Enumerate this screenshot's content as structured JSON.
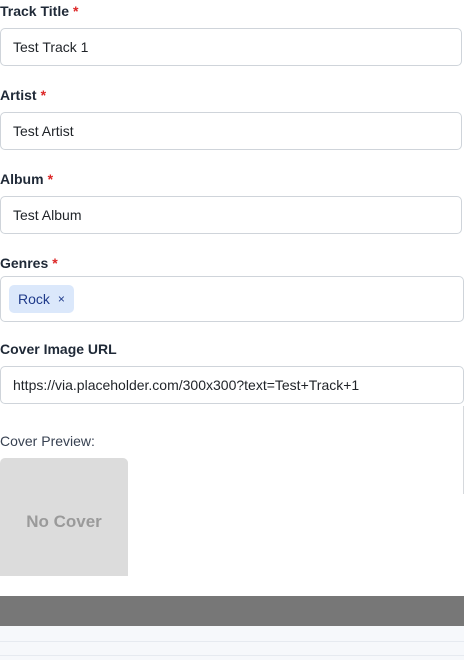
{
  "form": {
    "track_title": {
      "label": "Track Title",
      "required_mark": "*",
      "value": "Test Track 1"
    },
    "artist": {
      "label": "Artist",
      "required_mark": "*",
      "value": "Test Artist"
    },
    "album": {
      "label": "Album",
      "required_mark": "*",
      "value": "Test Album"
    },
    "genres": {
      "label": "Genres",
      "required_mark": "*",
      "tags": [
        {
          "label": "Rock",
          "remove_icon": "×"
        }
      ]
    },
    "cover_image_url": {
      "label": "Cover Image URL",
      "value": "https://via.placeholder.com/300x300?text=Test+Track+1"
    },
    "cover_preview": {
      "label": "Cover Preview:",
      "placeholder_text": "No Cover"
    }
  },
  "colors": {
    "required": "#dc2626",
    "tag_background": "#dbe8fb",
    "tag_text": "#1e3a8a",
    "cover_background": "#dcdcdc",
    "overlay": "#777777"
  },
  "icons": {
    "tag_remove": "close-icon"
  }
}
